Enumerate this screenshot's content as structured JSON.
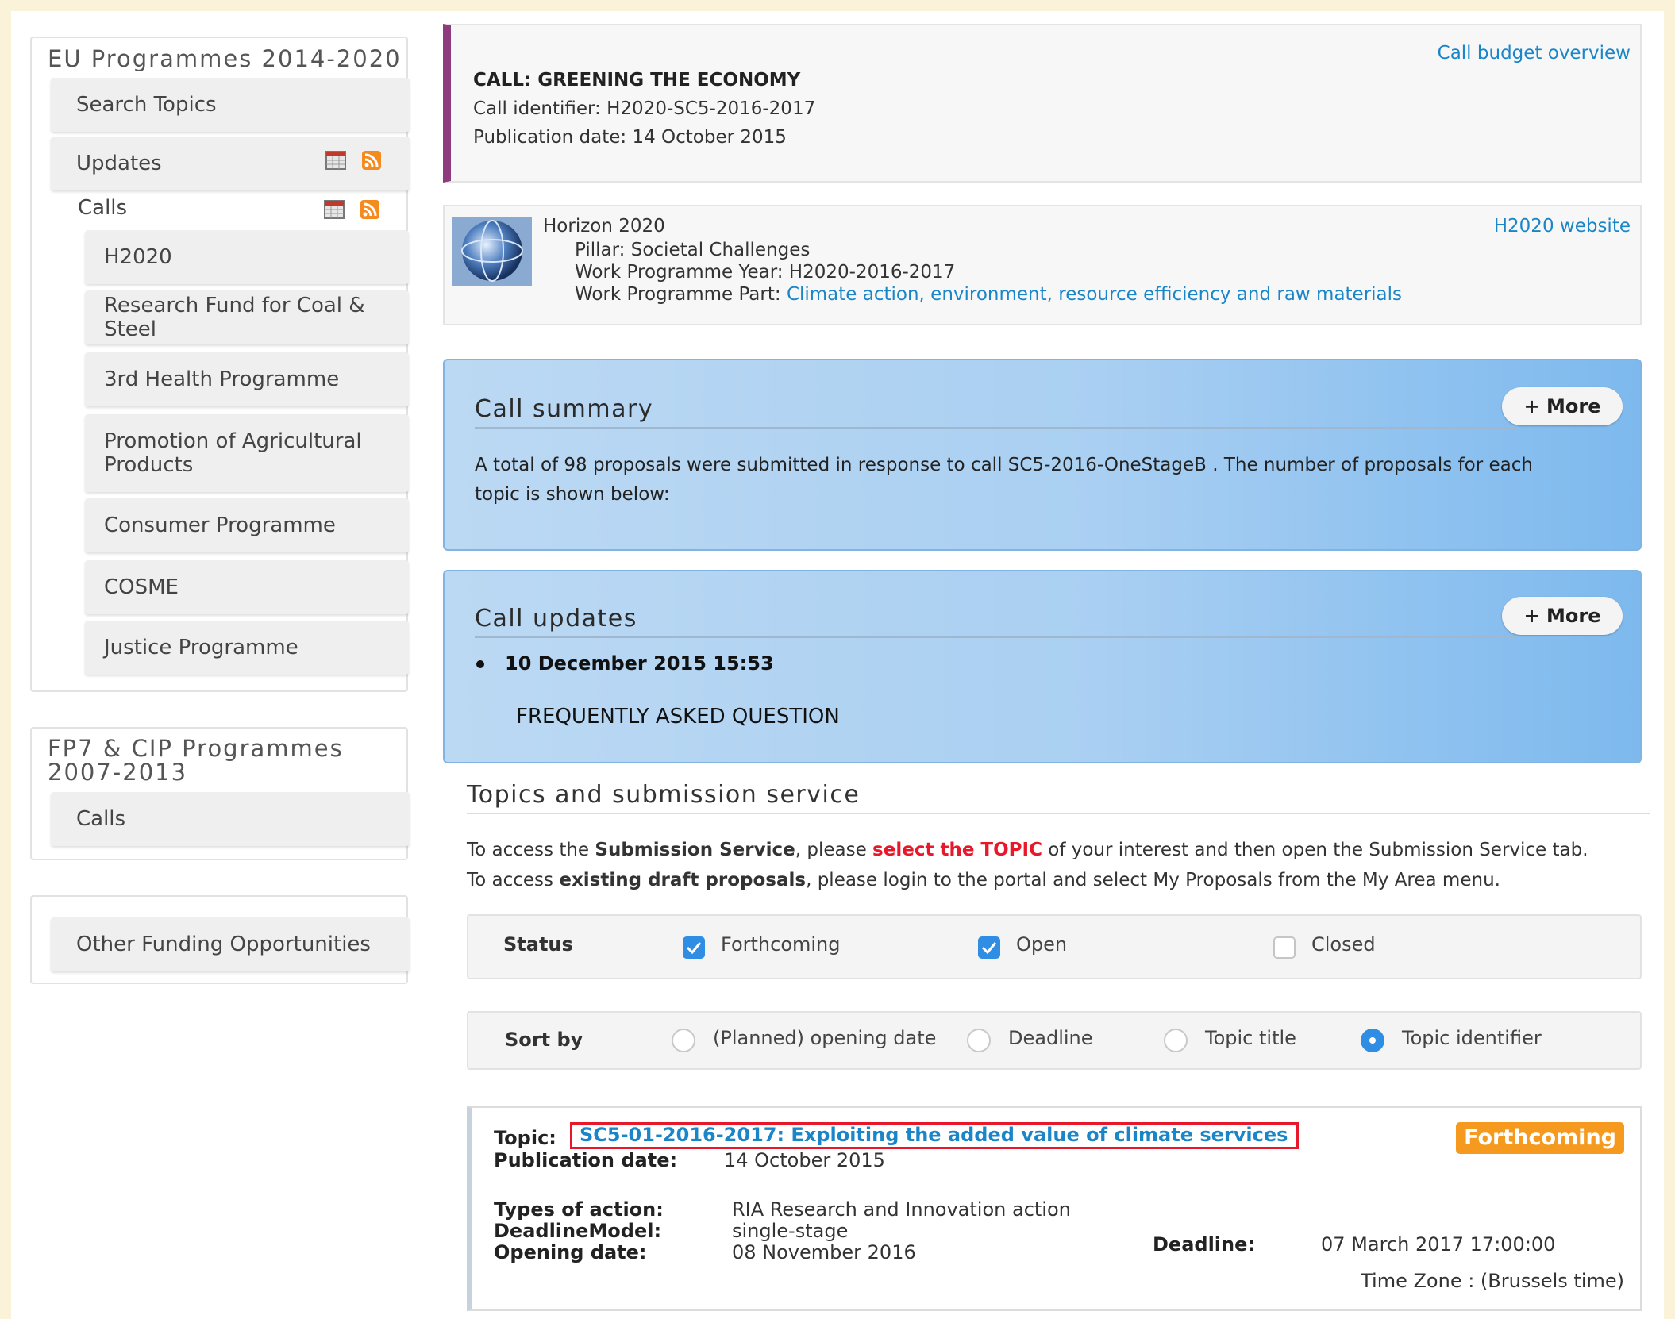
{
  "sidebar": {
    "eu_title": "EU Programmes 2014-2020",
    "search_topics": "Search Topics",
    "updates": "Updates",
    "calls": "Calls",
    "call_items": [
      "H2020",
      "Research Fund for Coal & Steel",
      "3rd Health Programme",
      "Promotion of Agricultural Products",
      "Consumer Programme",
      "COSME",
      "Justice Programme"
    ],
    "fp7_title": "FP7 & CIP Programmes 2007-2013",
    "fp7_calls": "Calls",
    "other_funding": "Other Funding Opportunities",
    "icons": [
      "calendar-icon",
      "rss-icon"
    ]
  },
  "call": {
    "title": "CALL: GREENING THE ECONOMY",
    "identifier": "Call identifier: H2020-SC5-2016-2017",
    "publication": "Publication date: 14 October 2015",
    "budget_link": "Call budget overview"
  },
  "programme": {
    "name": "Horizon 2020",
    "pillar": "Pillar: Societal Challenges",
    "wp_year": "Work Programme Year: H2020-2016-2017",
    "wp_part_label": "Work Programme Part: ",
    "wp_part_link": "Climate action, environment, resource efficiency and raw materials",
    "website_link": "H2020 website"
  },
  "summary": {
    "title": "Call summary",
    "more": "+ More",
    "text": "A total of 98 proposals were submitted in response to call SC5-2016-OneStageB . The number of proposals for each topic is shown below:"
  },
  "updates": {
    "title": "Call updates",
    "more": "+ More",
    "date": "10 December 2015 15:53",
    "faq": "FREQUENTLY ASKED QUESTION"
  },
  "topics_section": {
    "title": "Topics and submission service",
    "line1_a": "To access the ",
    "line1_b": "Submission Service",
    "line1_c": ", please ",
    "line1_d": "select the TOPIC",
    "line1_e": " of your interest and then open the Submission Service tab.",
    "line2_a": "To access ",
    "line2_b": "existing draft proposals",
    "line2_c": ", please login to the portal and select My Proposals from the My Area menu."
  },
  "status_filter": {
    "label": "Status",
    "options": [
      {
        "label": "Forthcoming",
        "checked": true
      },
      {
        "label": "Open",
        "checked": true
      },
      {
        "label": "Closed",
        "checked": false
      }
    ]
  },
  "sort_filter": {
    "label": "Sort by",
    "options": [
      {
        "label": "(Planned) opening date",
        "selected": false
      },
      {
        "label": "Deadline",
        "selected": false
      },
      {
        "label": "Topic title",
        "selected": false
      },
      {
        "label": "Topic identifier",
        "selected": true
      }
    ]
  },
  "topic": {
    "label": "Topic:",
    "link": "SC5-01-2016-2017: Exploiting the added value of climate services",
    "badge": "Forthcoming",
    "pub_label": "Publication date:",
    "pub_value": "14 October 2015",
    "types_label": "Types of action:",
    "types_value": "RIA Research and Innovation action",
    "model_label": "DeadlineModel:",
    "model_value": "single-stage",
    "opening_label": "Opening date:",
    "opening_value": "08 November 2016",
    "deadline_label": "Deadline:",
    "deadline_value": "07 March 2017 17:00:00",
    "timezone": "Time Zone : (Brussels time)"
  },
  "colors": {
    "accent_link": "#1a86c8",
    "call_bar": "#8e3b7f",
    "badge": "#f59a1e",
    "highlight_red": "#e8182a",
    "checkbox_blue": "#2f8de4"
  }
}
